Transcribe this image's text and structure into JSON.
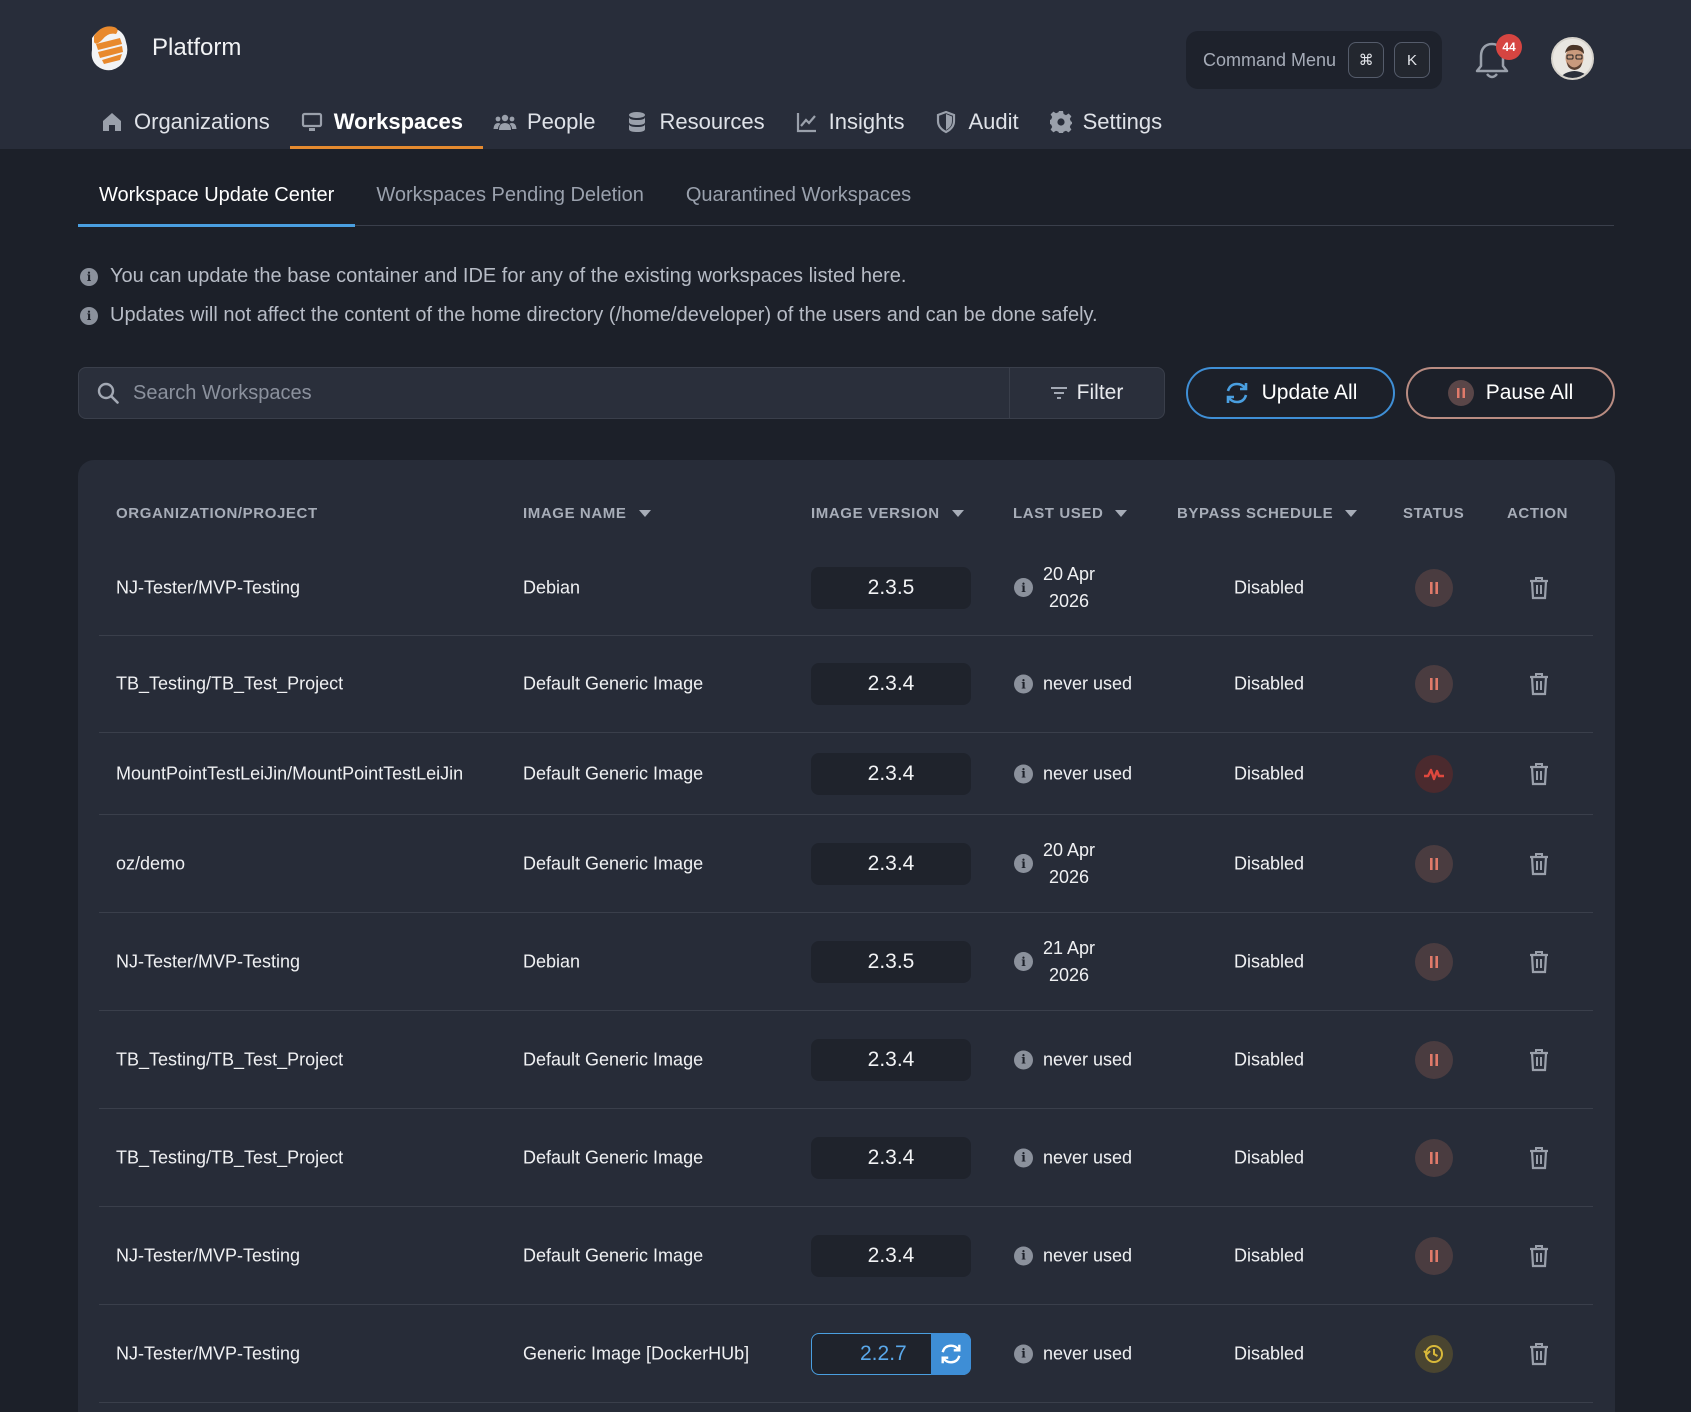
{
  "app": {
    "title": "Platform"
  },
  "command_menu": {
    "label": "Command Menu",
    "keys": [
      "⌘",
      "K"
    ]
  },
  "notifications": {
    "count": "44"
  },
  "nav": {
    "items": [
      {
        "label": "Organizations",
        "icon": "home-icon"
      },
      {
        "label": "Workspaces",
        "icon": "monitor-icon",
        "active": true
      },
      {
        "label": "People",
        "icon": "people-icon"
      },
      {
        "label": "Resources",
        "icon": "database-icon"
      },
      {
        "label": "Insights",
        "icon": "chart-line-icon"
      },
      {
        "label": "Audit",
        "icon": "shield-icon"
      },
      {
        "label": "Settings",
        "icon": "gear-icon"
      }
    ]
  },
  "subtabs": [
    {
      "label": "Workspace Update Center",
      "active": true
    },
    {
      "label": "Workspaces Pending Deletion"
    },
    {
      "label": "Quarantined Workspaces"
    }
  ],
  "info_lines": [
    "You can update the base container and IDE for any of the existing workspaces listed here.",
    "Updates will not affect the content of the home directory (/home/developer) of the users and can be done safely."
  ],
  "search": {
    "placeholder": "Search Workspaces",
    "value": ""
  },
  "toolbar": {
    "filter_label": "Filter",
    "update_all_label": "Update All",
    "pause_all_label": "Pause All"
  },
  "table": {
    "columns": [
      "ORGANIZATION/PROJECT",
      "IMAGE NAME",
      "IMAGE VERSION",
      "LAST USED",
      "BYPASS SCHEDULE",
      "STATUS",
      "ACTION"
    ],
    "rows": [
      {
        "org": "NJ-Tester/MVP-Testing",
        "image": "Debian",
        "version": "2.3.5",
        "last_used": [
          "20 Apr",
          "2026"
        ],
        "bypass": "Disabled",
        "status": "paused"
      },
      {
        "org": "TB_Testing/TB_Test_Project",
        "image": "Default Generic Image",
        "version": "2.3.4",
        "last_used": [
          "never used"
        ],
        "bypass": "Disabled",
        "status": "paused"
      },
      {
        "org": "MountPointTestLeiJin/MountPointTestLeiJin",
        "image": "Default Generic Image",
        "version": "2.3.4",
        "last_used": [
          "never used"
        ],
        "bypass": "Disabled",
        "status": "error"
      },
      {
        "org": "oz/demo",
        "image": "Default Generic Image",
        "version": "2.3.4",
        "last_used": [
          "20 Apr",
          "2026"
        ],
        "bypass": "Disabled",
        "status": "paused"
      },
      {
        "org": "NJ-Tester/MVP-Testing",
        "image": "Debian",
        "version": "2.3.5",
        "last_used": [
          "21 Apr",
          "2026"
        ],
        "bypass": "Disabled",
        "status": "paused"
      },
      {
        "org": "TB_Testing/TB_Test_Project",
        "image": "Default Generic Image",
        "version": "2.3.4",
        "last_used": [
          "never used"
        ],
        "bypass": "Disabled",
        "status": "paused"
      },
      {
        "org": "TB_Testing/TB_Test_Project",
        "image": "Default Generic Image",
        "version": "2.3.4",
        "last_used": [
          "never used"
        ],
        "bypass": "Disabled",
        "status": "paused"
      },
      {
        "org": "NJ-Tester/MVP-Testing",
        "image": "Default Generic Image",
        "version": "2.3.4",
        "last_used": [
          "never used"
        ],
        "bypass": "Disabled",
        "status": "paused"
      },
      {
        "org": "NJ-Tester/MVP-Testing",
        "image": "Generic Image [DockerHUb]",
        "version": "2.2.7",
        "last_used": [
          "never used"
        ],
        "bypass": "Disabled",
        "status": "scheduled",
        "update_available": true
      }
    ]
  },
  "colors": {
    "background": "#1c2029",
    "header": "#282d3a",
    "accent_nav": "#e58a2f",
    "accent_tab": "#4a9fe0",
    "badge": "#d64541"
  }
}
